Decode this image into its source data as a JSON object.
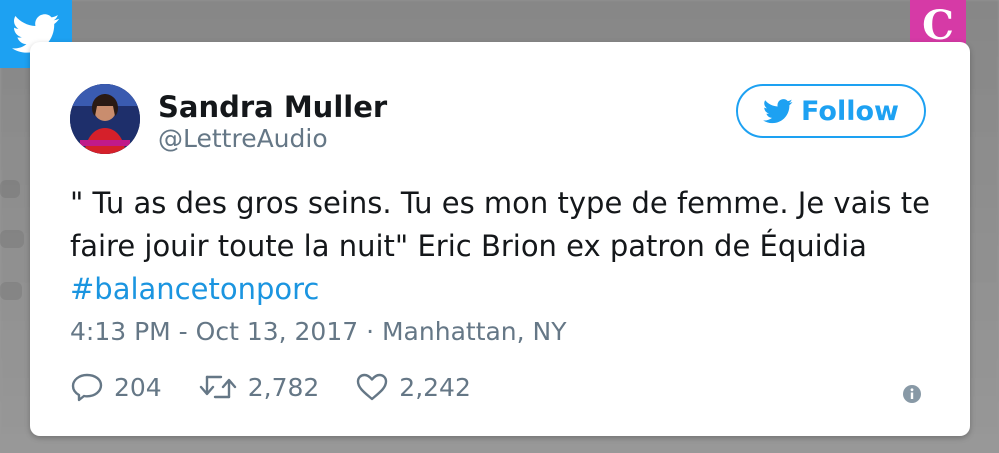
{
  "badge": {
    "letter": "C"
  },
  "tweet": {
    "author_name": "Sandra Muller",
    "author_handle": "@LettreAudio",
    "follow_label": "Follow",
    "text_main": "\" Tu as des gros seins. Tu es mon type de femme. Je vais te faire jouir toute la nuit\" Eric Brion ex patron de Équidia ",
    "hashtag": "#balancetonporc",
    "meta": "4:13 PM - Oct 13, 2017 · Manhattan, NY",
    "replies": "204",
    "retweets": "2,782",
    "likes": "2,242"
  },
  "colors": {
    "twitter_blue": "#1da1f2",
    "badge_pink": "#d63aa6",
    "text_gray": "#657786"
  },
  "icons": {
    "corner": "twitter-bird-icon",
    "follow": "twitter-bird-icon",
    "reply": "reply-icon",
    "retweet": "retweet-icon",
    "like": "heart-icon",
    "info": "info-icon"
  }
}
